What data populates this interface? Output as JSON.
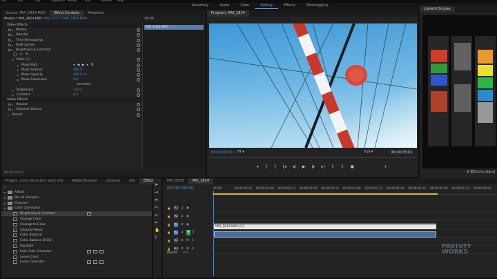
{
  "menu": [
    "File",
    "Edit",
    "Clip",
    "Sequence",
    "Marker",
    "Title",
    "Window",
    "Help"
  ],
  "workspaces": [
    {
      "label": "Assembly",
      "active": false
    },
    {
      "label": "Audio",
      "active": false
    },
    {
      "label": "Color",
      "active": false
    },
    {
      "label": "Editing",
      "active": true
    },
    {
      "label": "Effects",
      "active": false
    },
    {
      "label": "Metalogging",
      "active": false
    }
  ],
  "source_panel": {
    "tabs": [
      "Source: MVI_1814.MOV",
      "Effect Controls",
      "Metadata"
    ],
    "active_tab": 1,
    "master_label": "Master * MVI_1814.MOV",
    "sequence_label": "MVI_1814 * MVI_1814.MOV",
    "timecode_start": ":00:00",
    "clip_name": "MVI_1814.MOV",
    "rows": [
      {
        "label": "Video Effects",
        "indent": 0,
        "value": "",
        "section": true
      },
      {
        "label": "Motion",
        "indent": 1,
        "value": "",
        "toggle": true
      },
      {
        "label": "Opacity",
        "indent": 1,
        "value": "",
        "toggle": true
      },
      {
        "label": "Time Remapping",
        "indent": 1,
        "value": "",
        "toggle": true
      },
      {
        "label": "RGB Curves",
        "indent": 1,
        "value": "",
        "toggle": true
      },
      {
        "label": "Brightness & Contrast",
        "indent": 1,
        "value": "",
        "toggle": true
      },
      {
        "label": "",
        "indent": 2,
        "value": "",
        "masks": true
      },
      {
        "label": "Mask (1)",
        "indent": 2,
        "value": ""
      },
      {
        "label": "Mask Path",
        "indent": 3,
        "value": "",
        "nav": true
      },
      {
        "label": "Mask Feather",
        "indent": 3,
        "value": "285.0"
      },
      {
        "label": "Mask Opacity",
        "indent": 3,
        "value": "100.0 %"
      },
      {
        "label": "Mask Expansion",
        "indent": 3,
        "value": "0.0"
      },
      {
        "label": "",
        "indent": 3,
        "value": "Inverted",
        "plain": true
      },
      {
        "label": "Brightness",
        "indent": 2,
        "value": "-24.8"
      },
      {
        "label": "Contrast",
        "indent": 2,
        "value": "0.0"
      },
      {
        "label": "Audio Effects",
        "indent": 0,
        "value": "",
        "section": true
      },
      {
        "label": "Volume",
        "indent": 1,
        "value": "",
        "toggle": true
      },
      {
        "label": "Channel Volume",
        "indent": 1,
        "value": "",
        "toggle": true
      },
      {
        "label": "Panner",
        "indent": 1,
        "value": ""
      }
    ],
    "bottom_timecode": "00:00:00:00"
  },
  "program": {
    "title": "Program: MVI_1814",
    "timecode": "00;00;00;00",
    "fit": "Fit",
    "quality": "Full",
    "duration": "00;00;05;01"
  },
  "lumetri": {
    "title": "Lumetri Scopes",
    "clamp_label": "Clamp Signal"
  },
  "effects_panel": {
    "tabs": [
      "Project: color correction work v01",
      "Media Browser",
      "Libraries",
      "Info",
      "Effects"
    ],
    "active_tab": 4,
    "items": [
      {
        "label": "Adjust",
        "type": "folder",
        "indent": 0
      },
      {
        "label": "Blur & Sharpen",
        "type": "folder",
        "indent": 0
      },
      {
        "label": "Channel",
        "type": "folder",
        "indent": 0
      },
      {
        "label": "Color Correction",
        "type": "folder",
        "indent": 0,
        "open": true
      },
      {
        "label": "Brightness & Contrast",
        "type": "effect",
        "indent": 1,
        "selected": true,
        "badges": 1
      },
      {
        "label": "Change Color",
        "type": "effect",
        "indent": 1
      },
      {
        "label": "Change to Color",
        "type": "effect",
        "indent": 1
      },
      {
        "label": "Channel Mixer",
        "type": "effect",
        "indent": 1
      },
      {
        "label": "Color Balance",
        "type": "effect",
        "indent": 1
      },
      {
        "label": "Color Balance (HLS)",
        "type": "effect",
        "indent": 1
      },
      {
        "label": "Equalize",
        "type": "effect",
        "indent": 1
      },
      {
        "label": "Fast Color Corrector",
        "type": "effect",
        "indent": 1,
        "badges": 3
      },
      {
        "label": "Leave Color",
        "type": "effect",
        "indent": 1
      },
      {
        "label": "Luma Corrector",
        "type": "effect",
        "indent": 1,
        "badges": 3
      }
    ]
  },
  "timeline": {
    "tabs": [
      "MVI_0875",
      "MVI_1814"
    ],
    "active_tab": 1,
    "timecode": "00:00:00:00",
    "ruler": [
      ":00:00",
      "00:00:00:12",
      "00:00:01:00",
      "00:00:01:12",
      "00:00:02:00",
      "00:00:02:12",
      "00:00:03:00",
      "00:00:03:12",
      "00:00:04:00",
      "00:00:04:12",
      "00:00:05:00",
      "00:00:05:12",
      "00:00:06:00"
    ],
    "tracks": [
      {
        "name": "V3",
        "kind": "video"
      },
      {
        "name": "V2",
        "kind": "video"
      },
      {
        "name": "V1",
        "kind": "video"
      },
      {
        "name": "A1",
        "kind": "audio"
      },
      {
        "name": "A2",
        "kind": "audio"
      },
      {
        "name": "A3",
        "kind": "audio"
      }
    ],
    "master_label": "Master",
    "master_value": "0.0",
    "video_clip": "MVI_1814.MOV [V]"
  },
  "watermark": {
    "line1": "PROTOTY",
    "line2": "WORKS"
  }
}
